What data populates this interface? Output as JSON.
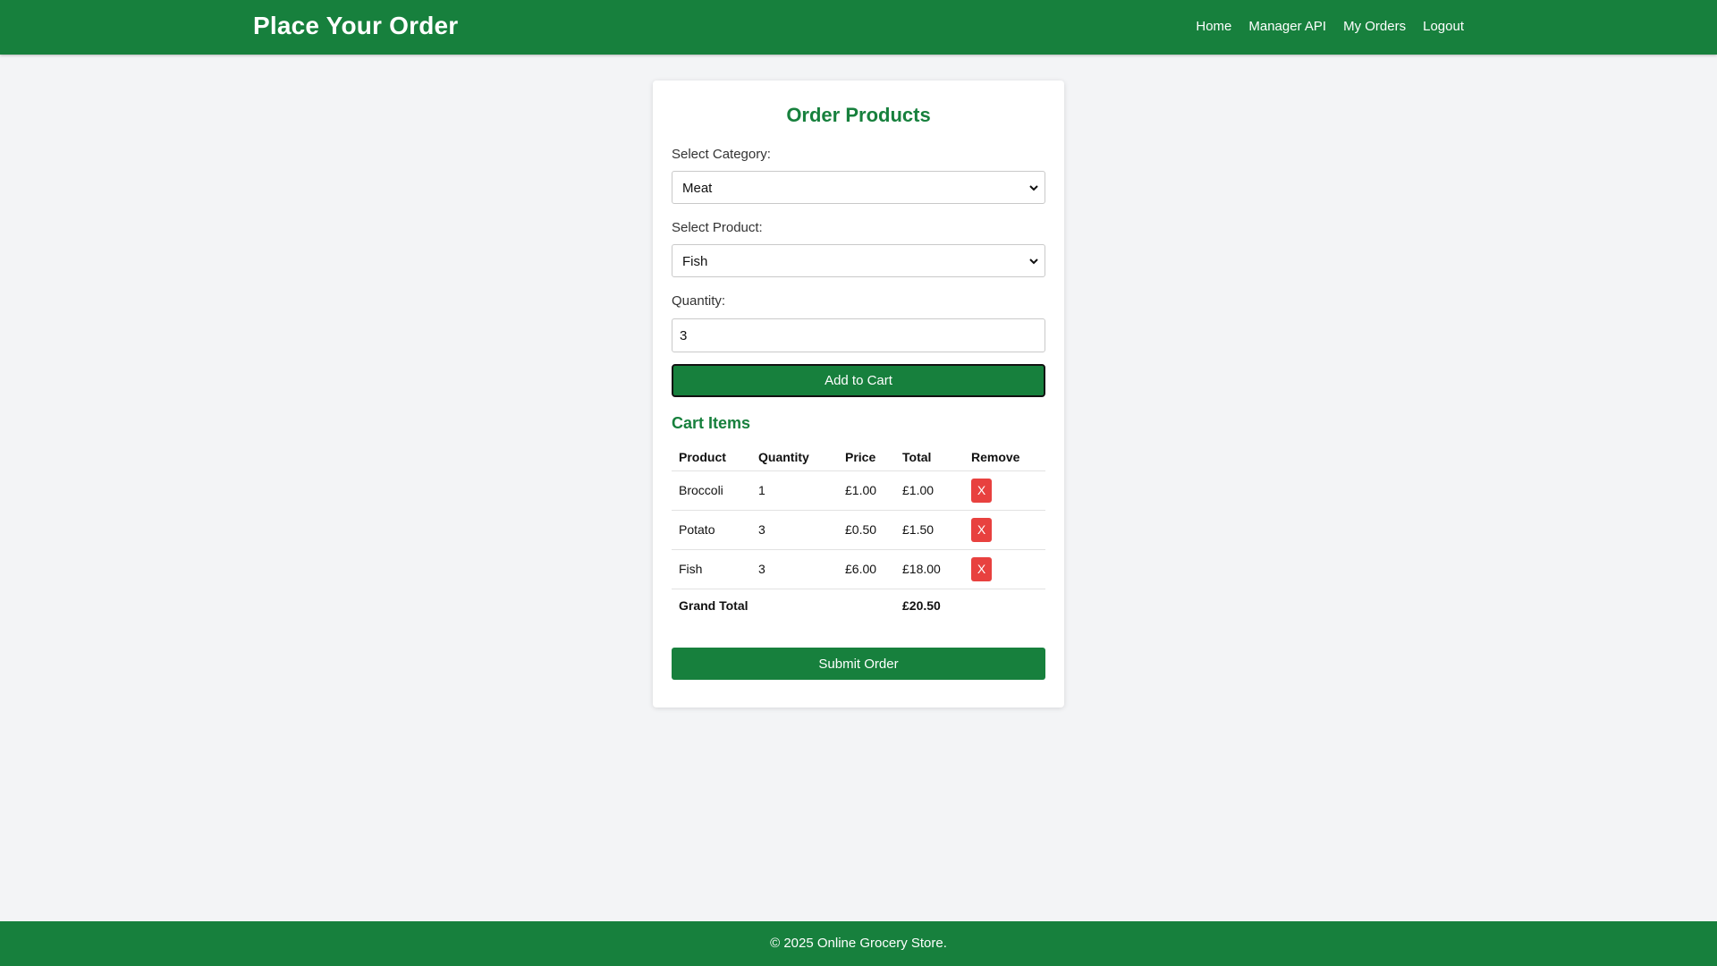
{
  "header": {
    "title": "Place Your Order",
    "nav": [
      "Home",
      "Manager API",
      "My Orders",
      "Logout"
    ]
  },
  "form": {
    "heading": "Order Products",
    "category_label": "Select Category:",
    "category_value": "Meat",
    "product_label": "Select Product:",
    "product_value": "Fish",
    "quantity_label": "Quantity:",
    "quantity_value": "3",
    "add_button": "Add to Cart"
  },
  "cart": {
    "heading": "Cart Items",
    "columns": [
      "Product",
      "Quantity",
      "Price",
      "Total",
      "Remove"
    ],
    "rows": [
      {
        "product": "Broccoli",
        "quantity": "1",
        "price": "£1.00",
        "total": "£1.00",
        "remove": "X"
      },
      {
        "product": "Potato",
        "quantity": "3",
        "price": "£0.50",
        "total": "£1.50",
        "remove": "X"
      },
      {
        "product": "Fish",
        "quantity": "3",
        "price": "£6.00",
        "total": "£18.00",
        "remove": "X"
      }
    ],
    "grand_total_label": "Grand Total",
    "grand_total_value": "£20.50",
    "submit_button": "Submit Order"
  },
  "footer": {
    "text": "© 2025 Online Grocery Store."
  },
  "colors": {
    "brand_green": "#17803d",
    "remove_red": "#e8413f",
    "background": "#f3f4f6"
  }
}
